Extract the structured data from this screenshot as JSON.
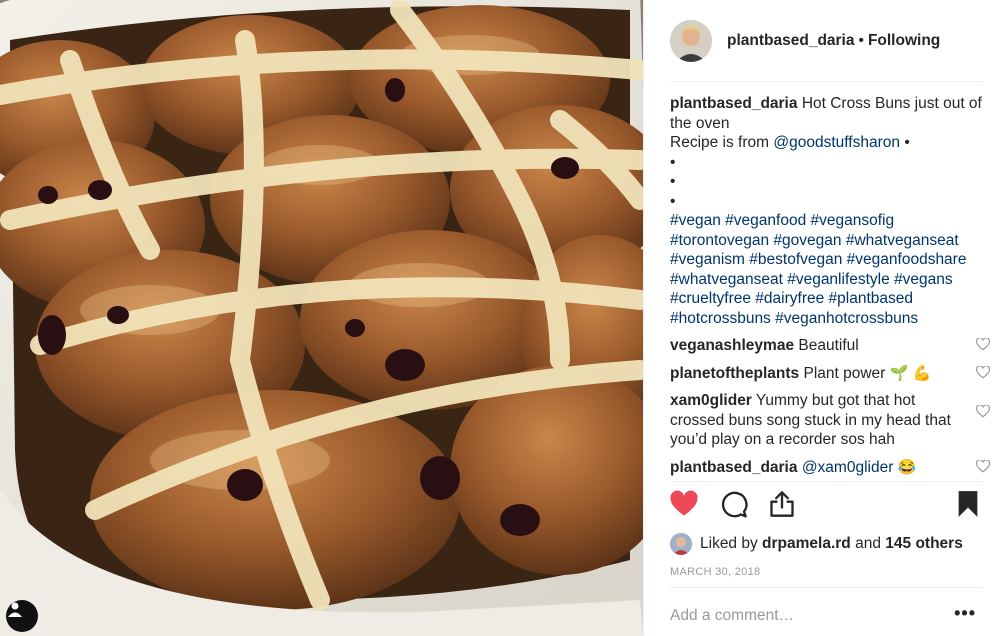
{
  "post": {
    "username": "plantbased_daria",
    "follow_status": "Following",
    "caption": {
      "author": "plantbased_daria",
      "line1": "Hot Cross Buns just out of the oven",
      "line2_prefix": "Recipe is from",
      "mention": "@goodstuffsharon",
      "line2_suffix": "•",
      "bullets": [
        "•",
        "•",
        "•"
      ],
      "hashtags": [
        "#vegan",
        "#veganfood",
        "#vegansofig",
        "#torontovegan",
        "#govegan",
        "#whatveganseat",
        "#veganism",
        "#bestofvegan",
        "#veganfoodshare",
        "#whatveganseat",
        "#veganlifestyle",
        "#vegans",
        "#crueltyfree",
        "#dairyfree",
        "#plantbased",
        "#hotcrossbuns",
        "#veganhotcrossbuns"
      ]
    },
    "comments": [
      {
        "author": "veganashleymae",
        "text": "Beautiful"
      },
      {
        "author": "planetoftheplants",
        "text": "Plant power",
        "emoji": "🌱 💪"
      },
      {
        "author": "xam0glider",
        "text": "Yummy but got that hot crossed buns song stuck in my head that you’d play on a recorder sos hah"
      },
      {
        "author": "plantbased_daria",
        "mention": "@xam0glider",
        "emoji": "😂"
      }
    ],
    "likes": {
      "prefix": "Liked by",
      "user": "drpamela.rd",
      "and": "and",
      "others": "145 others"
    },
    "date": "MARCH 30, 2018",
    "comment_placeholder": "Add a comment…",
    "more_label": "•••",
    "liked": true,
    "colors": {
      "heart": "#ed4956",
      "link": "#003569",
      "muted": "#999999"
    },
    "icons": [
      "heart-filled-icon",
      "comment-icon",
      "share-icon",
      "bookmark-icon",
      "heart-outline-icon",
      "user-tag-icon"
    ]
  }
}
